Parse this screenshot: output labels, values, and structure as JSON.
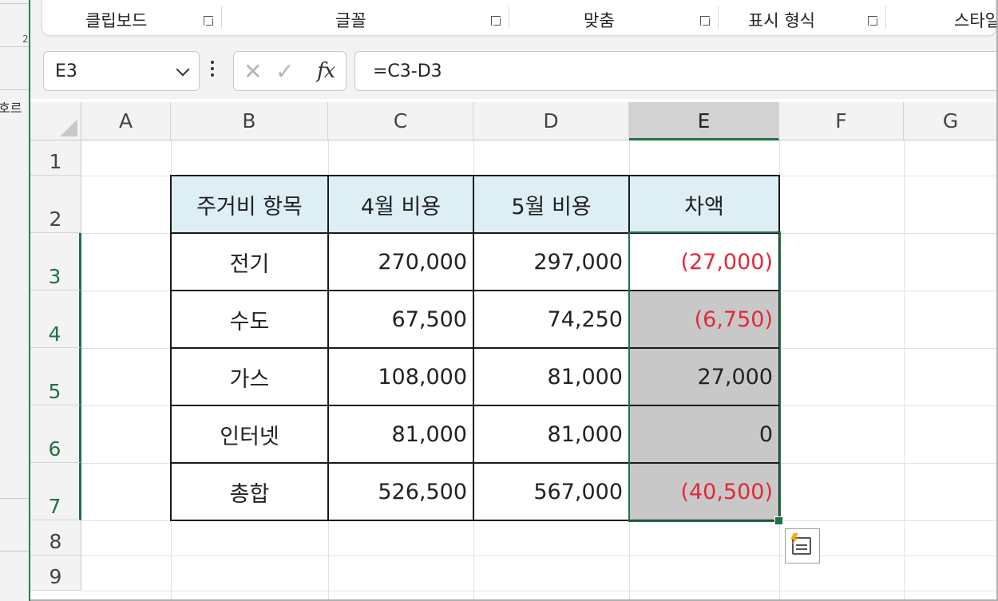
{
  "background_window": {
    "fragment_text": "호르",
    "number_text": "2"
  },
  "ribbon": {
    "groups": [
      {
        "label": "클립보드"
      },
      {
        "label": "글꼴"
      },
      {
        "label": "맞춤"
      },
      {
        "label": "표시 형식"
      },
      {
        "label": "스타일"
      }
    ]
  },
  "formula_bar": {
    "name_box": "E3",
    "cancel_glyph": "✕",
    "enter_glyph": "✓",
    "fx_label": "fx",
    "formula": "=C3-D3"
  },
  "columns": [
    "A",
    "B",
    "C",
    "D",
    "E",
    "F",
    "G"
  ],
  "rows": [
    "1",
    "2",
    "3",
    "4",
    "5",
    "6",
    "7",
    "8",
    "9"
  ],
  "selection": {
    "active_cell": "E3",
    "selected_range": "E3:E7"
  },
  "table": {
    "headers": [
      "주거비 항목",
      "4월 비용",
      "5월 비용",
      "차액"
    ],
    "rows": [
      [
        "전기",
        "270,000",
        "297,000",
        "(27,000)"
      ],
      [
        "수도",
        "67,500",
        "74,250",
        "(6,750)"
      ],
      [
        "가스",
        "108,000",
        "81,000",
        "27,000"
      ],
      [
        "인터넷",
        "81,000",
        "81,000",
        "0"
      ],
      [
        "총합",
        "526,500",
        "567,000",
        "(40,500)"
      ]
    ]
  },
  "colors": {
    "header_fill": "#ddeef5",
    "grey_fill": "#c8c8c8",
    "negative_text": "#e4283a",
    "selection_green": "#1e7145"
  },
  "icons": {
    "quick_analysis": "quick-analysis-icon"
  }
}
